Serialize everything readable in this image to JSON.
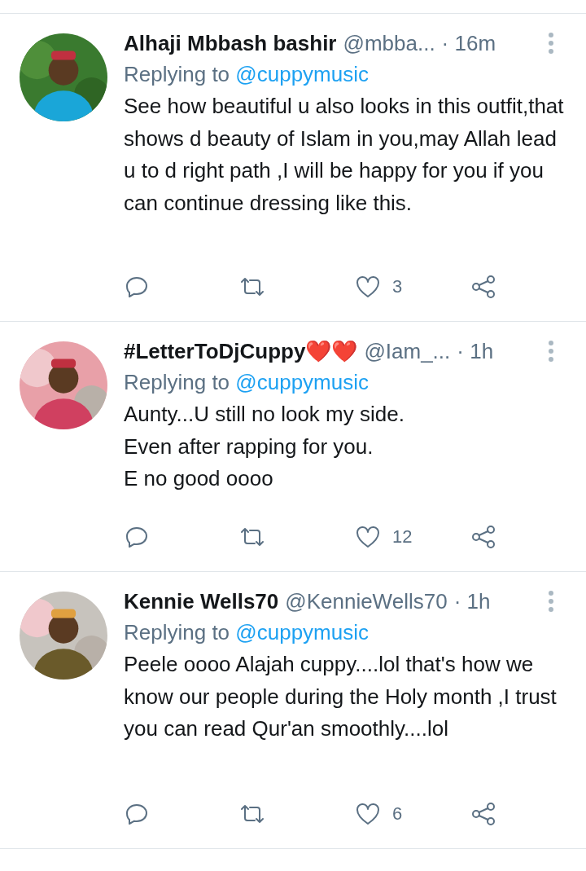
{
  "tweets": [
    {
      "name": "Alhaji Mbbash bashir",
      "handle": "@mbba...",
      "time": "· 16m",
      "replying": "Replying to",
      "mention": "@cuppymusic",
      "text": "See how beautiful u also looks in this outfit,that shows d beauty of Islam in you,may Allah lead u to d right path ,I will be happy for you if you can continue dressing like this.",
      "likes": "3"
    },
    {
      "name": "#LetterToDjCuppy❤️❤️",
      "handle": "@Iam_...",
      "time": "· 1h",
      "replying": "Replying to",
      "mention": "@cuppymusic",
      "text": "Aunty...U still no look my side.\nEven after rapping for you.\nE no good oooo",
      "likes": "12"
    },
    {
      "name": "Kennie Wells70",
      "handle": "@KennieWells70",
      "time": "· 1h",
      "replying": "Replying to",
      "mention": "@cuppymusic",
      "text": "Peele oooo Alajah cuppy....lol that's how we know our people during the Holy month ,I trust you can read Qur'an smoothly....lol",
      "likes": "6"
    }
  ]
}
